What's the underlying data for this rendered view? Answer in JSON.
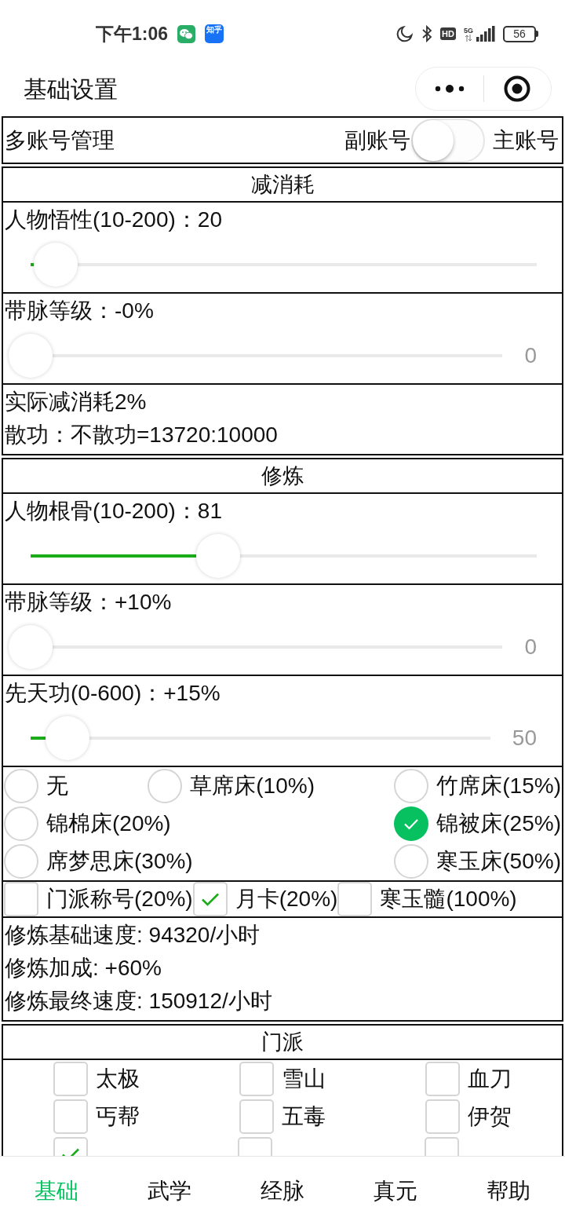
{
  "status_bar": {
    "time": "下午1:06",
    "notifications": [
      {
        "kind": "chat"
      },
      {
        "kind": "app",
        "label": "知乎"
      }
    ],
    "hd": "HD",
    "network": "5G",
    "battery": "56"
  },
  "header": {
    "title": "基础设置"
  },
  "account": {
    "label": "多账号管理",
    "off_label": "副账号",
    "on_label": "主账号",
    "on": false
  },
  "sections": [
    {
      "title": "减消耗",
      "rows": [
        {
          "kind": "slider",
          "label": "人物悟性(10-200)：20",
          "level": 0.05
        },
        {
          "kind": "slider",
          "label": "带脉等级：-0%",
          "level": 0,
          "reading": "0"
        },
        {
          "kind": "info",
          "lines": [
            "实际减消耗2%",
            "散功：不散功=13720:10000"
          ]
        }
      ]
    },
    {
      "title": "修炼",
      "rows": [
        {
          "kind": "slider",
          "label": "人物根骨(10-200)：81",
          "level": 0.37
        },
        {
          "kind": "slider",
          "label": "带脉等级：+10%",
          "level": 0,
          "reading": "0"
        },
        {
          "kind": "slider",
          "label": "先天功(0-600)：+15%",
          "level": 0.08,
          "reading": "50"
        },
        {
          "kind": "radios",
          "options": [
            {
              "label": "无",
              "selected": false
            },
            {
              "label": "草席床(10%)",
              "selected": false
            },
            {
              "label": "竹席床(15%)",
              "selected": false
            },
            {
              "label": "锦棉床(20%)",
              "selected": false
            },
            {
              "label": "锦被床(25%)",
              "selected": true
            },
            {
              "label": "席梦思床(30%)",
              "selected": false
            },
            {
              "label": "寒玉床(50%)",
              "selected": false
            }
          ]
        },
        {
          "kind": "checks",
          "options": [
            {
              "label": "门派称号(20%)",
              "checked": false
            },
            {
              "label": "月卡(20%)",
              "checked": true
            },
            {
              "label": "寒玉髓(100%)",
              "checked": false
            }
          ]
        },
        {
          "kind": "info",
          "lines": [
            "修炼基础速度: 94320/小时",
            "修炼加成: +60%",
            "修炼最终速度: 150912/小时"
          ]
        }
      ]
    },
    {
      "title": "门派",
      "rows": [
        {
          "kind": "grid",
          "options": [
            {
              "label": "太极",
              "checked": false
            },
            {
              "label": "雪山",
              "checked": false
            },
            {
              "label": "血刀",
              "checked": false
            },
            {
              "label": "丐帮",
              "checked": false
            },
            {
              "label": "五毒",
              "checked": false
            },
            {
              "label": "伊贺",
              "checked": false
            },
            {
              "checked": true
            },
            {
              "checked": false
            },
            {
              "checked": false
            }
          ]
        }
      ]
    }
  ],
  "tab_bar": [
    {
      "label": "基础",
      "selected": true
    },
    {
      "label": "武学",
      "selected": false
    },
    {
      "label": "经脉",
      "selected": false
    },
    {
      "label": "真元",
      "selected": false
    },
    {
      "label": "帮助",
      "selected": false
    }
  ]
}
